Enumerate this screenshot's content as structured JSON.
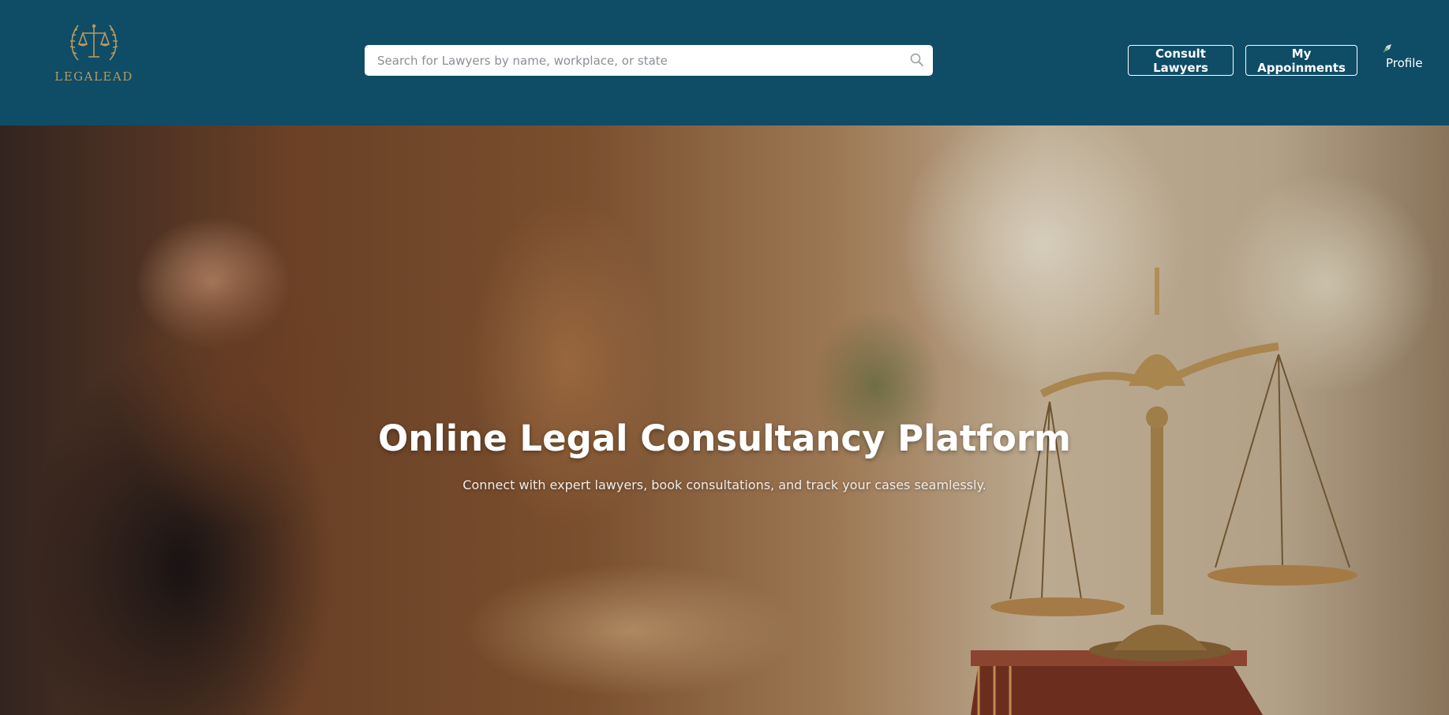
{
  "brand": {
    "logo_text": "LEGALEAD",
    "logo_icon": "scales-of-justice-wreath-icon",
    "logo_color": "#b89a5e"
  },
  "header": {
    "background": "#0f4c66",
    "search": {
      "placeholder": "Search for Lawyers by name, workplace, or state",
      "value": "",
      "icon": "search-icon"
    },
    "nav": {
      "consult_label": "Consult Lawyers",
      "appointments_label": "My Appoinments",
      "profile_label": "Profile",
      "profile_icon": "profile-avatar-icon"
    }
  },
  "hero": {
    "title": "Online Legal Consultancy Platform",
    "subtitle": "Connect with expert lawyers, book consultations, and track your cases seamlessly.",
    "background_image": "blurred-lawyer-writing-with-scales-of-justice"
  }
}
